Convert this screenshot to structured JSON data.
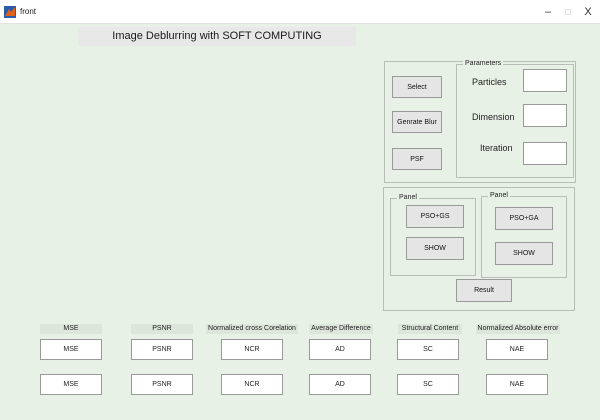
{
  "window": {
    "title": "front",
    "minimize": "–",
    "maximize": "□",
    "close": "X"
  },
  "heading": "Image Deblurring with SOFT COMPUTING",
  "actions": {
    "select": "Select",
    "blur": "Genrate Blur",
    "psf": "PSF"
  },
  "parameters": {
    "title": "Parameters",
    "particles_label": "Particles",
    "dimension_label": "Dimension",
    "iteration_label": "Iteration",
    "particles_value": "",
    "dimension_value": "",
    "iteration_value": ""
  },
  "panel_gs": {
    "title": "Panel",
    "run": "PSO+GS",
    "show": "SHOW"
  },
  "panel_ga": {
    "title": "Panel",
    "run": "PSO+GA",
    "show": "SHOW"
  },
  "result_button": "Result",
  "metrics": [
    {
      "label": "MSE",
      "row1": "MSE",
      "row2": "MSE"
    },
    {
      "label": "PSNR",
      "row1": "PSNR",
      "row2": "PSNR"
    },
    {
      "label": "Normalized cross Corelation",
      "row1": "NCR",
      "row2": "NCR"
    },
    {
      "label": "Average Difference",
      "row1": "AD",
      "row2": "AD"
    },
    {
      "label": "Structural Content",
      "row1": "SC",
      "row2": "SC"
    },
    {
      "label": "Normalized Absolute error",
      "row1": "NAE",
      "row2": "NAE"
    }
  ]
}
